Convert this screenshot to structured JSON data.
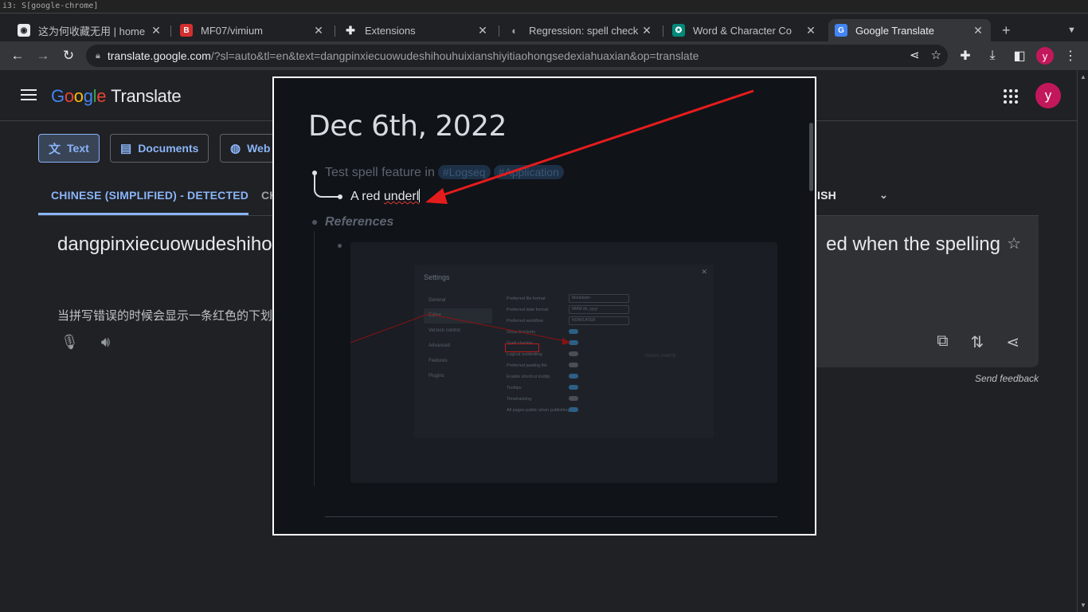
{
  "i3bar": {
    "text": "i3: S[google-chrome]"
  },
  "tabs": [
    {
      "title": "这为何收藏无用 | home",
      "fav_color": "#e8eaed",
      "fav_glyph": "◉",
      "icon": "github-icon"
    },
    {
      "title": "MF07/vimium",
      "fav_color": "#d32f2f",
      "fav_glyph": "B",
      "icon": "repo-icon"
    },
    {
      "title": "Extensions",
      "fav_color": "#202124",
      "fav_glyph": "✚",
      "icon": "puzzle-icon"
    },
    {
      "title": "Regression: spell check",
      "fav_color": "#202124",
      "fav_glyph": "◐",
      "icon": "github-icon"
    },
    {
      "title": "Word & Character Co",
      "fav_color": "#00897b",
      "fav_glyph": "✪",
      "icon": "counter-icon"
    },
    {
      "title": "Google Translate",
      "fav_color": "#4285f4",
      "fav_glyph": "G",
      "icon": "translate-icon"
    }
  ],
  "url": {
    "host": "translate.google.com",
    "path": "/?sl=auto&tl=en&text=dangpinxiecuowudeshihouhuixianshiyitiaohongsedexiahuaxian&op=translate"
  },
  "profile_initial": "y",
  "gt": {
    "product": "Translate",
    "logo": [
      "G",
      "o",
      "o",
      "g",
      "l",
      "e"
    ],
    "modes": [
      "Text",
      "Documents",
      "Web"
    ],
    "src_lang_active": "CHINESE (SIMPLIFIED) - DETECTED",
    "src_lang_2": "CH",
    "tgt_lang": "ISH",
    "source_text": "dangpinxiecuowudeshiho exiahuaxian",
    "source_translit": "当拼写错误的时候会显示一条红色的下划",
    "target_text": "ed when the spelling",
    "send_feedback": "Send feedback"
  },
  "overlay": {
    "date": "Dec 6th, 2022",
    "line1": "Test spell feature in",
    "tags": [
      "#Logseq",
      "#Application"
    ],
    "line2_prefix": "A red ",
    "line2_misspelled": "underl",
    "refs": "References",
    "embed": {
      "title": "Settings",
      "nav": [
        "General",
        "Editor",
        "Version control",
        "Advanced",
        "Features",
        "Plugins"
      ],
      "opts": [
        "Preferred file format",
        "Preferred date format",
        "Preferred workflow",
        "Show brackets",
        "Spell checker",
        "Logical outdenting",
        "Preferred pasting file",
        "Enable shortcut tooltip",
        "Tooltips",
        "Timetracking",
        "All pages public when publishing"
      ],
      "select_values": [
        "Markdown",
        "MMM do, yyyy",
        "NOW/LATER"
      ],
      "shortcut": "mod+c mod+b"
    }
  },
  "colors": {
    "accent": "#8ab4f8",
    "annotation": "#e51c1c",
    "avatar": "#c2185b"
  }
}
